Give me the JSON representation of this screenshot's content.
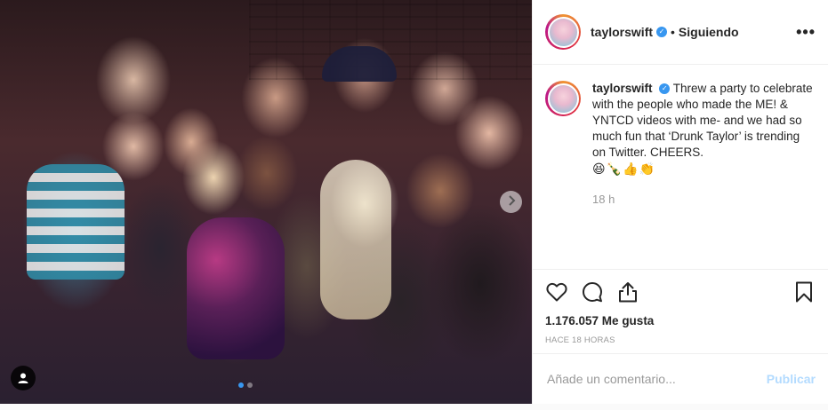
{
  "header": {
    "username": "taylorswift",
    "separator": "•",
    "follow_state": "Siguiendo",
    "more_label": "•••"
  },
  "caption": {
    "username": "taylorswift",
    "text": "Threw a party to celebrate with the people who made the ME! & YNTCD videos with me- and we had so much fun that ‘Drunk Taylor’ is trending on Twitter. CHEERS.",
    "emojis": "😆🍾👍👏",
    "age": "18 h"
  },
  "actions": {
    "likes": "1.176.057 Me gusta",
    "timestamp": "HACE 18 HORAS"
  },
  "comment_box": {
    "placeholder": "Añade un comentario...",
    "publish_label": "Publicar"
  },
  "icons": {
    "verified": "verified-badge-icon",
    "like": "heart-icon",
    "comment": "comment-icon",
    "share": "share-icon",
    "save": "bookmark-icon",
    "user_tag": "user-tag-icon",
    "next": "chevron-right-icon"
  },
  "carousel": {
    "count": 2,
    "active_index": 0
  },
  "colors": {
    "accent": "#3897f0",
    "publish_disabled": "#b3dbff",
    "text": "#262626",
    "muted": "#999999"
  }
}
